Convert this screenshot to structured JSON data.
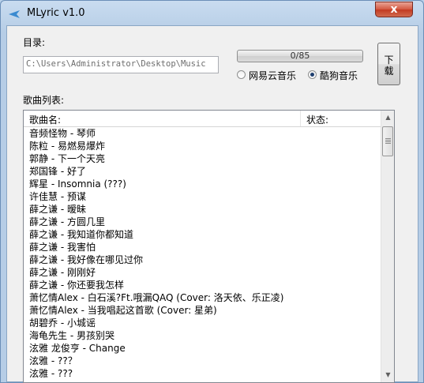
{
  "window": {
    "title": "MLyric v1.0",
    "close_label": "x"
  },
  "directory": {
    "label": "目录:",
    "value": "C:\\Users\\Administrator\\Desktop\\Music"
  },
  "progress": {
    "text": "0/85",
    "fraction": 0.0
  },
  "sources": {
    "netease": {
      "label": "网易云音乐",
      "selected": false
    },
    "kugou": {
      "label": "酷狗音乐",
      "selected": true
    }
  },
  "download_button": {
    "label_line1": "下",
    "label_line2": "载"
  },
  "song_list": {
    "label": "歌曲列表:",
    "columns": {
      "name": "歌曲名:",
      "status": "状态:"
    },
    "rows": [
      "音频怪物 - 琴师",
      "陈粒 - 易燃易爆炸",
      "郭静 - 下一个天亮",
      "郑国锋 - 好了",
      "辉星 - Insomnia (???)",
      "许佳慧 - 预谋",
      "薛之谦 - 暧昧",
      "薛之谦 - 方圆几里",
      "薛之谦 - 我知道你都知道",
      "薛之谦 - 我害怕",
      "薛之谦 - 我好像在哪见过你",
      "薛之谦 - 刚刚好",
      "薛之谦 - 你还要我怎样",
      "萧忆情Alex - 白石溪?Ft.哦漏QAQ (Cover: 洛天依、乐正凌)",
      "萧忆情Alex - 当我唱起这首歌 (Cover: 星弟)",
      "胡碧乔 - 小城谣",
      "海龟先生 - 男孩别哭",
      "泫雅 龙俊亨 - Change",
      "泫雅 - ??？",
      "泫雅 - ???"
    ]
  }
}
